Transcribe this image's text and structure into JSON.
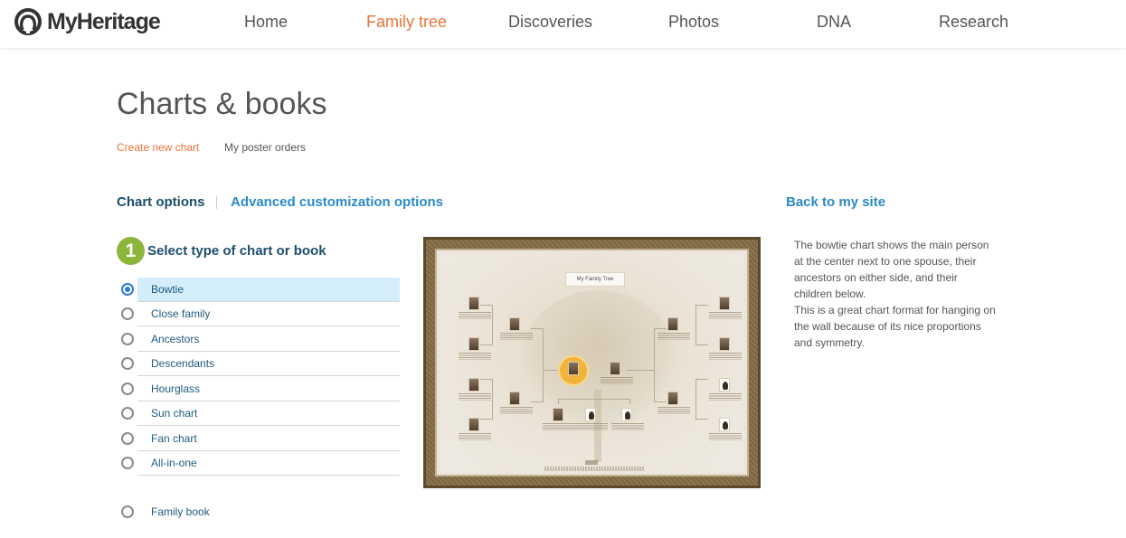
{
  "brand": {
    "name": "MyHeritage",
    "accent": "#e8743b",
    "link_color": "#2b8ac6",
    "heading_color": "#1c4e6e",
    "step_color": "#8cb53a"
  },
  "nav": {
    "items": [
      {
        "label": "Home",
        "active": false
      },
      {
        "label": "Family tree",
        "active": true
      },
      {
        "label": "Discoveries",
        "active": false
      },
      {
        "label": "Photos",
        "active": false
      },
      {
        "label": "DNA",
        "active": false
      },
      {
        "label": "Research",
        "active": false
      }
    ]
  },
  "page": {
    "title": "Charts & books",
    "subnav": {
      "create": "Create new chart",
      "orders": "My poster orders"
    }
  },
  "options": {
    "chart_options": "Chart options",
    "advanced": "Advanced customization options",
    "back": "Back to my site"
  },
  "step": {
    "number": "1",
    "title": "Select type of chart or book",
    "choices": [
      {
        "label": "Bowtie",
        "selected": true
      },
      {
        "label": "Close family",
        "selected": false
      },
      {
        "label": "Ancestors",
        "selected": false
      },
      {
        "label": "Descendants",
        "selected": false
      },
      {
        "label": "Hourglass",
        "selected": false
      },
      {
        "label": "Sun chart",
        "selected": false
      },
      {
        "label": "Fan chart",
        "selected": false
      },
      {
        "label": "All-in-one",
        "selected": false
      }
    ],
    "book_choice": {
      "label": "Family book",
      "selected": false
    }
  },
  "preview": {
    "poster_title": "My Family Tree",
    "image_alt": "Bowtie chart preview"
  },
  "description": {
    "line1": "The bowtie chart shows the main person at the center next to one spouse, their ancestors on either side, and their children below.",
    "line2": "This is a great chart format for hanging on the wall because of its nice proportions and symmetry."
  }
}
